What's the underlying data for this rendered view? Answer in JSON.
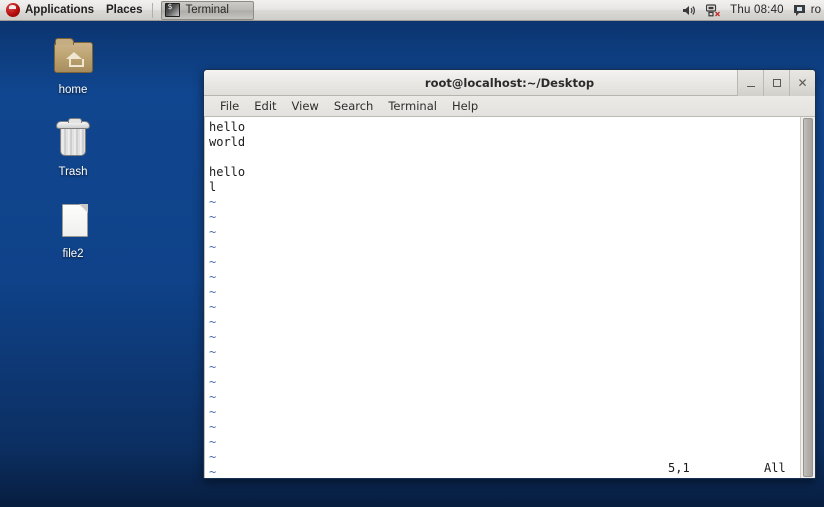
{
  "panel": {
    "applications_label": "Applications",
    "places_label": "Places",
    "logo_icon": "fedora-logo-icon",
    "taskbar": {
      "window_label": "Terminal",
      "window_icon": "terminal-icon"
    },
    "tray": {
      "volume_icon": "speaker-volume-icon",
      "network_icon": "network-disconnected-icon",
      "clock": "Thu 08:40",
      "user_icon": "user-messages-icon",
      "user_label": "ro"
    }
  },
  "desktop": {
    "icons": [
      {
        "name": "home",
        "label": "home",
        "icon": "home-folder-icon"
      },
      {
        "name": "trash",
        "label": "Trash",
        "icon": "trash-can-icon"
      },
      {
        "name": "file2",
        "label": "file2",
        "icon": "document-file-icon"
      }
    ]
  },
  "terminal": {
    "title": "root@localhost:~/Desktop",
    "window_buttons": {
      "minimize": "minimize-icon",
      "maximize": "maximize-icon",
      "close": "close-icon"
    },
    "menu": [
      {
        "label": "File"
      },
      {
        "label": "Edit"
      },
      {
        "label": "View"
      },
      {
        "label": "Search"
      },
      {
        "label": "Terminal"
      },
      {
        "label": "Help"
      }
    ],
    "content": {
      "lines": [
        "hello",
        "world",
        "",
        "hello",
        "l"
      ],
      "tilde": "~",
      "tilde_count": 19
    },
    "status": {
      "ruler": "5,1",
      "percent": "All"
    },
    "scrollbar": "vertical-scrollbar"
  },
  "colors": {
    "desktop_blue": "#10468f",
    "panel_grey": "#e7e5e3",
    "terminal_bg": "#ffffff",
    "tilde_blue": "#4a6fae",
    "accent_red": "#b50d0d"
  }
}
